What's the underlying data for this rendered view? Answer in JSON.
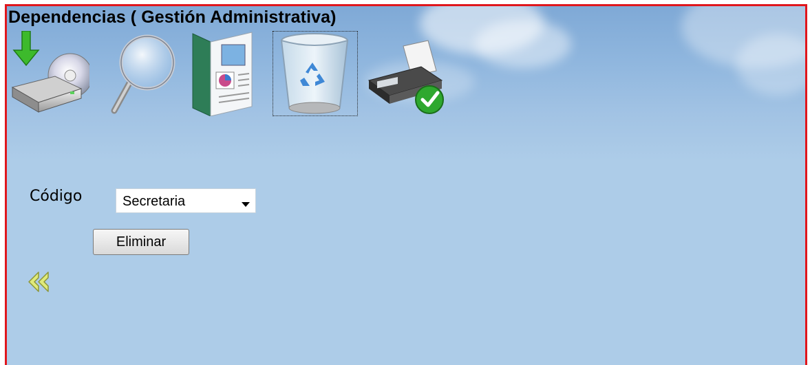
{
  "header": {
    "title": "Dependencias ( Gestión Administrativa)"
  },
  "toolbar": {
    "items": [
      {
        "name": "save-drive-icon"
      },
      {
        "name": "search-magnifier-icon"
      },
      {
        "name": "report-document-icon"
      },
      {
        "name": "recycle-bin-icon",
        "focused": true
      },
      {
        "name": "printer-check-icon"
      }
    ]
  },
  "form": {
    "code_label": "Código",
    "code_select": {
      "selected": "Secretaria"
    },
    "delete_button": "Eliminar"
  },
  "navigation": {
    "back_icon": "double-arrow-left-icon"
  },
  "colors": {
    "border": "#e0161c",
    "background": "#adcce8",
    "back_arrow": "#d8e36a"
  }
}
